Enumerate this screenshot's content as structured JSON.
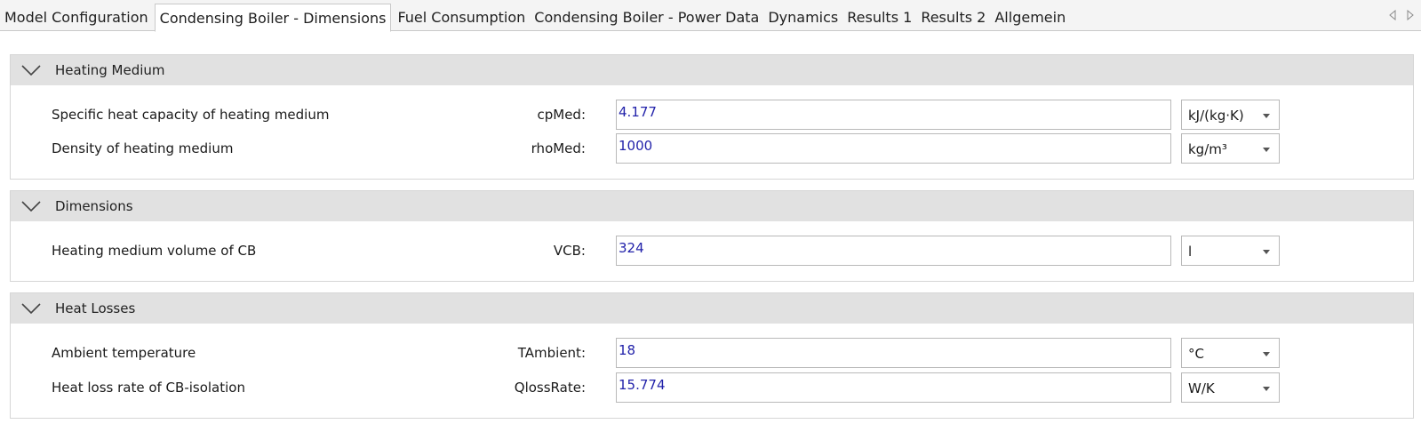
{
  "tabs": [
    {
      "label": "Model Configuration",
      "active": false
    },
    {
      "label": "Condensing Boiler - Dimensions",
      "active": true
    },
    {
      "label": "Fuel Consumption",
      "active": false
    },
    {
      "label": "Condensing Boiler - Power Data",
      "active": false
    },
    {
      "label": "Dynamics",
      "active": false
    },
    {
      "label": "Results 1",
      "active": false
    },
    {
      "label": "Results 2",
      "active": false
    },
    {
      "label": "Allgemein",
      "active": false
    }
  ],
  "sections": [
    {
      "title": "Heating Medium",
      "rows": [
        {
          "label": "Specific heat capacity of heating medium",
          "var": "cpMed:",
          "value": "4.177",
          "unit": "kJ/(kg·K)"
        },
        {
          "label": "Density of heating medium",
          "var": "rhoMed:",
          "value": "1000",
          "unit": "kg/m³"
        }
      ]
    },
    {
      "title": "Dimensions",
      "rows": [
        {
          "label": "Heating medium volume of CB",
          "var": "VCB:",
          "value": "324",
          "unit": "l"
        }
      ]
    },
    {
      "title": "Heat Losses",
      "rows": [
        {
          "label": "Ambient temperature",
          "var": "TAmbient:",
          "value": "18",
          "unit": "°C"
        },
        {
          "label": "Heat loss rate of CB-isolation",
          "var": "QlossRate:",
          "value": "15.774",
          "unit": "W/K"
        }
      ]
    }
  ],
  "colors": {
    "tab_bar": "#f4f4f4",
    "section_header": "#e1e1e1",
    "value_text": "#2222aa",
    "border": "#b9b9b9"
  }
}
